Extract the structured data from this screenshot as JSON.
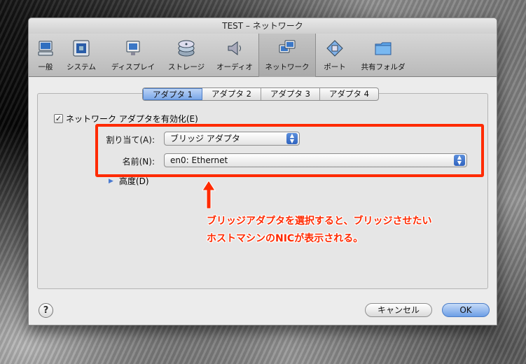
{
  "window": {
    "title": "TEST – ネットワーク"
  },
  "toolbar": {
    "items": [
      {
        "label": "一般",
        "icon": "computer-icon",
        "active": false
      },
      {
        "label": "システム",
        "icon": "chip-icon",
        "active": false
      },
      {
        "label": "ディスプレイ",
        "icon": "monitor-icon",
        "active": false
      },
      {
        "label": "ストレージ",
        "icon": "disks-icon",
        "active": false
      },
      {
        "label": "オーディオ",
        "icon": "speaker-icon",
        "active": false
      },
      {
        "label": "ネットワーク",
        "icon": "network-icon",
        "active": true
      },
      {
        "label": "ポート",
        "icon": "port-icon",
        "active": false
      },
      {
        "label": "共有フォルダ",
        "icon": "folder-icon",
        "active": false
      }
    ]
  },
  "tabs": [
    "アダプタ 1",
    "アダプタ 2",
    "アダプタ 3",
    "アダプタ 4"
  ],
  "selected_tab": 0,
  "enable_adapter": {
    "label": "ネットワーク アダプタを有効化(E)",
    "checked": true,
    "check_mark": "✓"
  },
  "attached_to": {
    "label": "割り当て(A):",
    "value": "ブリッジ アダプタ"
  },
  "name": {
    "label": "名前(N):",
    "value": "en0: Ethernet"
  },
  "advanced": {
    "label": "高度(D)"
  },
  "annotation": {
    "line1": "ブリッジアダプタを選択すると、ブリッジさせたい",
    "line2": "ホストマシンのNICが表示される。",
    "color": "#ff2a00"
  },
  "buttons": {
    "help": "?",
    "cancel": "キャンセル",
    "ok": "OK"
  },
  "colors": {
    "accent": "#4f7fc7",
    "highlight": "#ff2a00"
  }
}
